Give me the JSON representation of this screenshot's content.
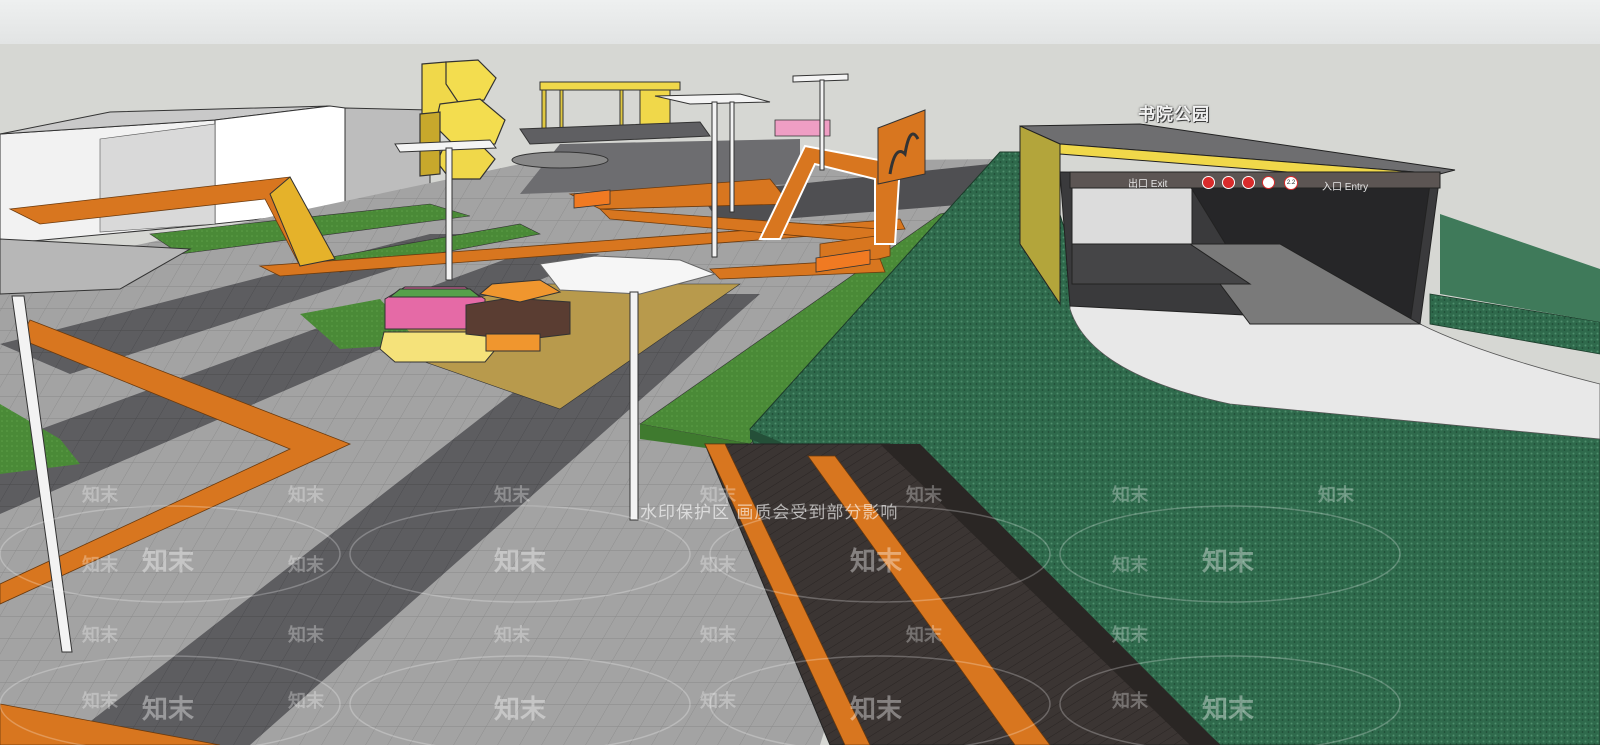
{
  "viewport": {
    "title": ""
  },
  "park_sign": {
    "text": "书院公园"
  },
  "garage": {
    "exit_label": "出口  Exit",
    "entry_label": "入口 Entry",
    "height_limit": "2.2"
  },
  "watermark": {
    "brand": "知末",
    "notice": "水印保护区  画质会受到部分影响"
  },
  "colors": {
    "sky": "#d6d7d3",
    "paving_light": "#9a9a9a",
    "paving_dark": "#5e5e60",
    "orange_band": "#d8761f",
    "lawn": "#2f6a4c",
    "grass": "#4e8a3a",
    "deck_wood": "#3a3432",
    "yellow_accent": "#f0d84a"
  }
}
